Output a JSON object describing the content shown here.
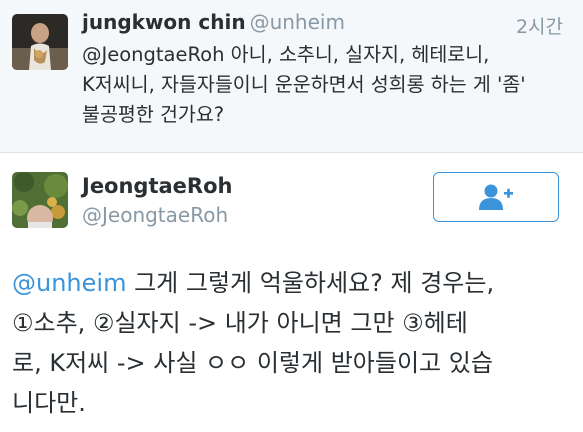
{
  "reply_tweet": {
    "author_name": "jungkwon chin",
    "author_handle": "@unheim",
    "timestamp": "2시간",
    "mention": "@JeongtaeRoh",
    "text": " 아니, 소추니, 실자지, 헤테로니, K저씨니, 자들자들이니 운운하면서 성희롱 하는 게 '좀'  불공평한 건가요?"
  },
  "main_tweet": {
    "author_name": "JeongtaeRoh",
    "author_handle": "@JeongtaeRoh",
    "mention": "@unheim",
    "text": " 그게 그렇게 억울하세요? 제 경우는,\n①소추, ②실자지 -> 내가 아니면 그만 ③헤테\n로, K저씨 -> 사실 ㅇㅇ 이렇게 받아들이고 있습\n니다만."
  },
  "icons": {
    "follow_button": "add-user-icon"
  },
  "colors": {
    "link": "#3b94d9",
    "secondary_text": "#8899a6",
    "reply_background": "#f5f8fa"
  }
}
